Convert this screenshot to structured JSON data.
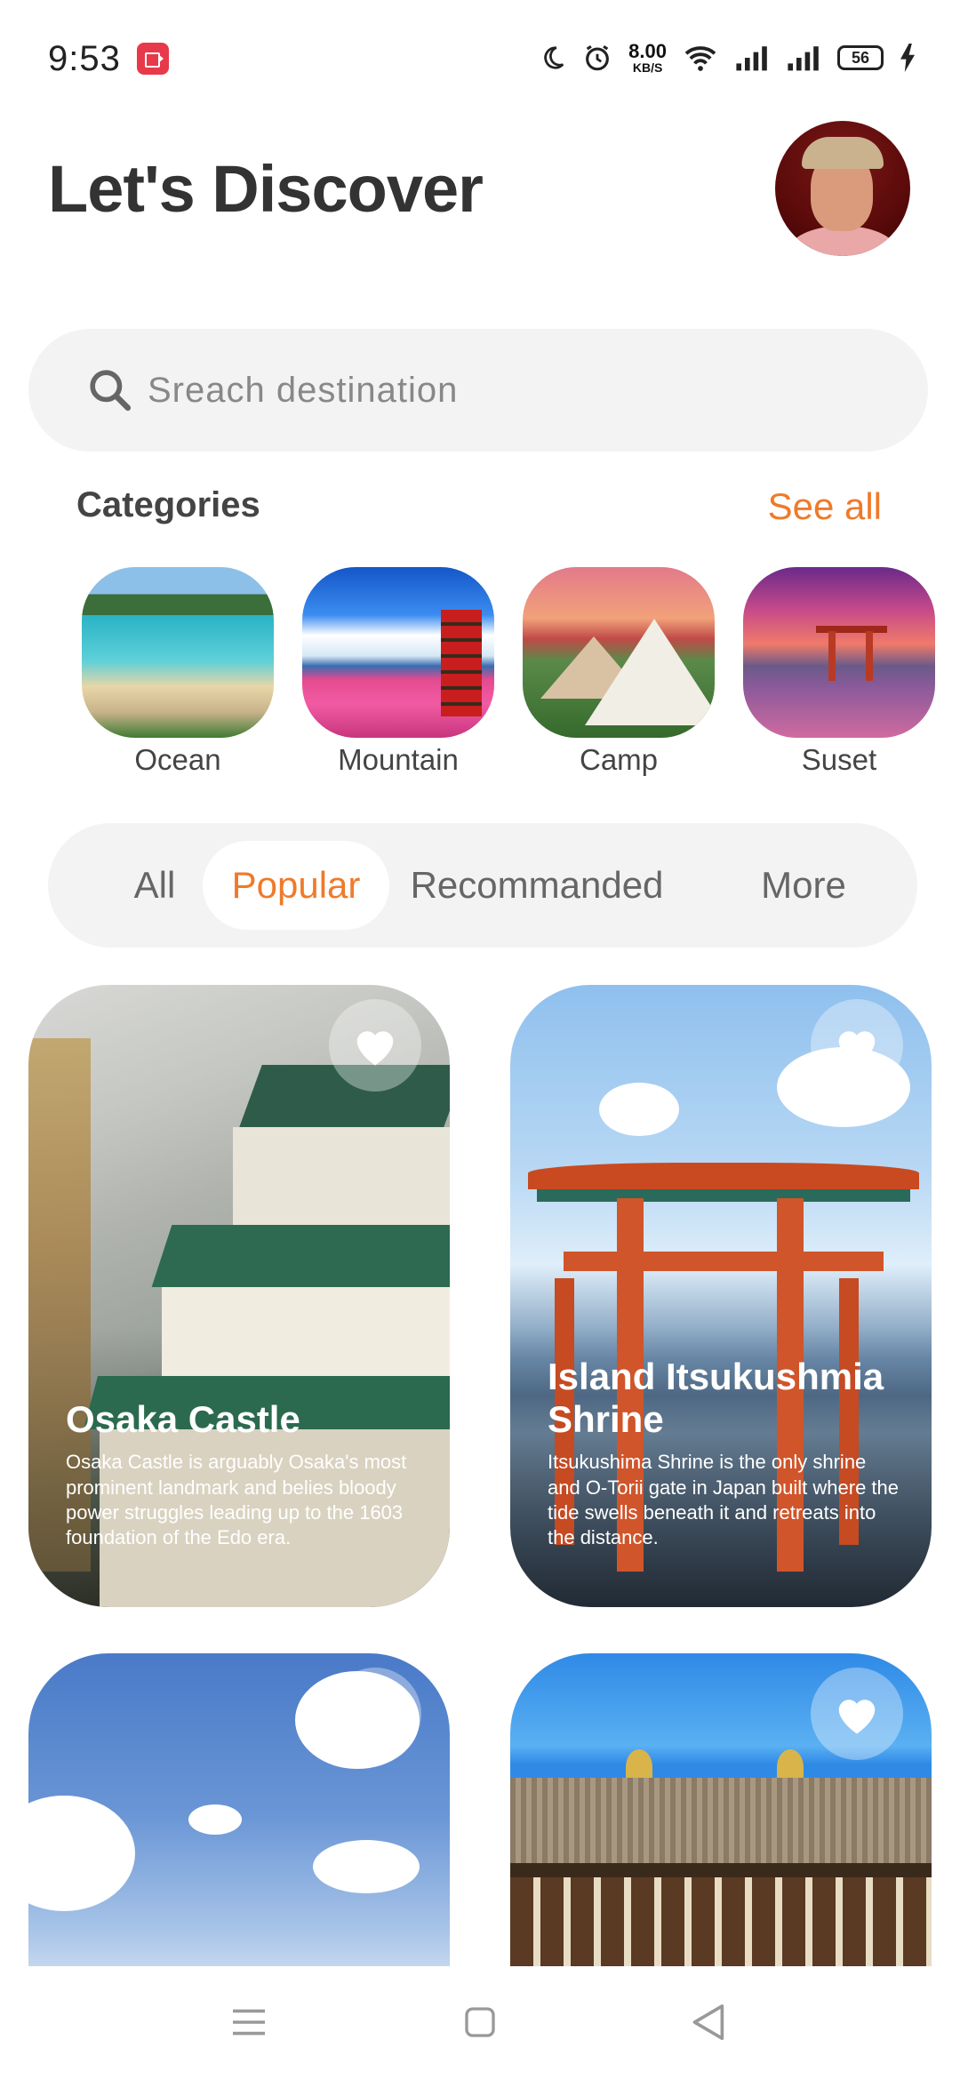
{
  "status_bar": {
    "time": "9:53",
    "speed_value": "8.00",
    "speed_unit": "KB/S",
    "battery": "56"
  },
  "header": {
    "title": "Let's Discover"
  },
  "search": {
    "placeholder": "Sreach destination"
  },
  "categories": {
    "title": "Categories",
    "see_all": "See all",
    "items": [
      {
        "label": "Ocean"
      },
      {
        "label": "Mountain"
      },
      {
        "label": "Camp"
      },
      {
        "label": "Suset"
      }
    ]
  },
  "tabs": [
    {
      "label": "All",
      "active": false
    },
    {
      "label": "Popular",
      "active": true
    },
    {
      "label": "Recommanded",
      "active": false
    },
    {
      "label": "More",
      "active": false
    }
  ],
  "places": [
    {
      "title": "Osaka Castle",
      "description": "Osaka Castle is arguably Osaka's most prominent landmark and belies bloody power struggles leading up to the 1603 foundation of the Edo era."
    },
    {
      "title": "Island Itsukushmia Shrine",
      "description": "Itsukushima Shrine is the only shrine and O-Torii gate in Japan built where the tide swells beneath it and retreats into the distance."
    }
  ],
  "colors": {
    "accent": "#f07a2a",
    "surface": "#f3f3f3",
    "text": "#333333"
  },
  "icons": {
    "search": "search-icon",
    "favorite": "heart-icon",
    "nav_menu": "menu-icon",
    "nav_home": "home-icon",
    "nav_back": "back-icon"
  }
}
